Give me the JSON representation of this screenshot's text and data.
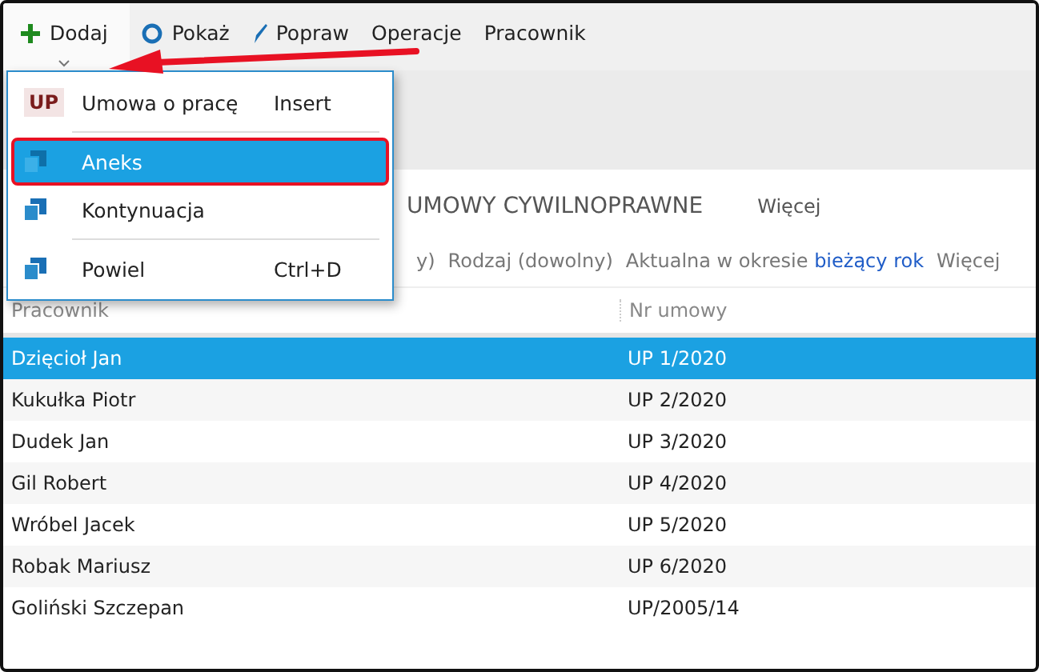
{
  "toolbar": [
    {
      "label": "Dodaj",
      "kind": "add",
      "dropdown": true
    },
    {
      "label": "Pokaż",
      "kind": "show",
      "dropdown": false
    },
    {
      "label": "Popraw",
      "kind": "edit",
      "dropdown": false
    },
    {
      "label": "Operacje",
      "kind": "text",
      "dropdown": false
    },
    {
      "label": "Pracownik",
      "kind": "text",
      "dropdown": false
    }
  ],
  "menu": {
    "items": [
      {
        "kind": "badge",
        "badge": "UP",
        "label": "Umowa o pracę",
        "shortcut": "Insert",
        "selected": false,
        "highlighted": false
      },
      {
        "kind": "separator"
      },
      {
        "kind": "copy",
        "label": "Aneks",
        "selected": true,
        "highlighted": true
      },
      {
        "kind": "copy",
        "label": "Kontynuacja",
        "selected": false,
        "highlighted": false
      },
      {
        "kind": "separator"
      },
      {
        "kind": "copy",
        "label": "Powiel",
        "shortcut": "Ctrl+D",
        "selected": false,
        "highlighted": false
      }
    ]
  },
  "tabs": [
    {
      "label": "UMOWY CYWILNOPRAWNE"
    },
    {
      "label": "Więcej"
    }
  ],
  "filters": [
    {
      "kind": "fragment",
      "text": "y)"
    },
    {
      "kind": "plain",
      "text": "Rodzaj (dowolny)"
    },
    {
      "kind": "period",
      "text": "Aktualna w okresie",
      "value": "bieżący rok"
    },
    {
      "kind": "plain",
      "text": "Więcej"
    }
  ],
  "table": {
    "columns": [
      "Pracownik",
      "Nr umowy"
    ],
    "rows": [
      {
        "cells": [
          "Dzięcioł Jan",
          "UP 1/2020"
        ],
        "selected": true
      },
      {
        "cells": [
          "Kukułka Piotr",
          "UP 2/2020"
        ],
        "selected": false
      },
      {
        "cells": [
          "Dudek Jan",
          "UP 3/2020"
        ],
        "selected": false
      },
      {
        "cells": [
          "Gil Robert",
          "UP 4/2020"
        ],
        "selected": false
      },
      {
        "cells": [
          "Wróbel Jacek",
          "UP 5/2020"
        ],
        "selected": false
      },
      {
        "cells": [
          "Robak Mariusz",
          "UP 6/2020"
        ],
        "selected": false
      },
      {
        "cells": [
          "Goliński Szczepan",
          "UP/2005/14"
        ],
        "selected": false
      }
    ]
  }
}
